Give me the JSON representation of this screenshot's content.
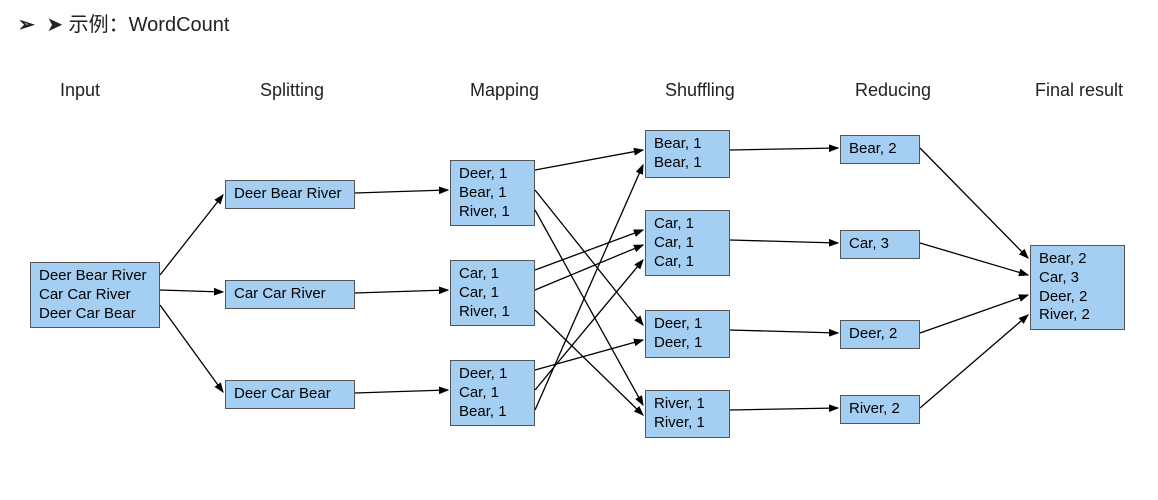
{
  "title_prefix": "➤ 示例：",
  "title_word": "WordCount",
  "stages": {
    "input": "Input",
    "splitting": "Splitting",
    "mapping": "Mapping",
    "shuffling": "Shuffling",
    "reducing": "Reducing",
    "final": "Final result"
  },
  "nodes": {
    "input": [
      "Deer Bear River",
      "Car Car River",
      "Deer Car Bear"
    ],
    "split": {
      "s1": "Deer Bear River",
      "s2": "Car Car River",
      "s3": "Deer Car Bear"
    },
    "map": {
      "m1": [
        "Deer, 1",
        "Bear, 1",
        "River, 1"
      ],
      "m2": [
        "Car, 1",
        "Car, 1",
        "River, 1"
      ],
      "m3": [
        "Deer, 1",
        "Car, 1",
        "Bear, 1"
      ]
    },
    "shuffle": {
      "sh1": [
        "Bear, 1",
        "Bear, 1"
      ],
      "sh2": [
        "Car, 1",
        "Car, 1",
        "Car, 1"
      ],
      "sh3": [
        "Deer, 1",
        "Deer, 1"
      ],
      "sh4": [
        "River, 1",
        "River, 1"
      ]
    },
    "reduce": {
      "r1": "Bear, 2",
      "r2": "Car, 3",
      "r3": "Deer, 2",
      "r4": "River, 2"
    },
    "final": [
      "Bear, 2",
      "Car, 3",
      "Deer, 2",
      "River, 2"
    ]
  }
}
